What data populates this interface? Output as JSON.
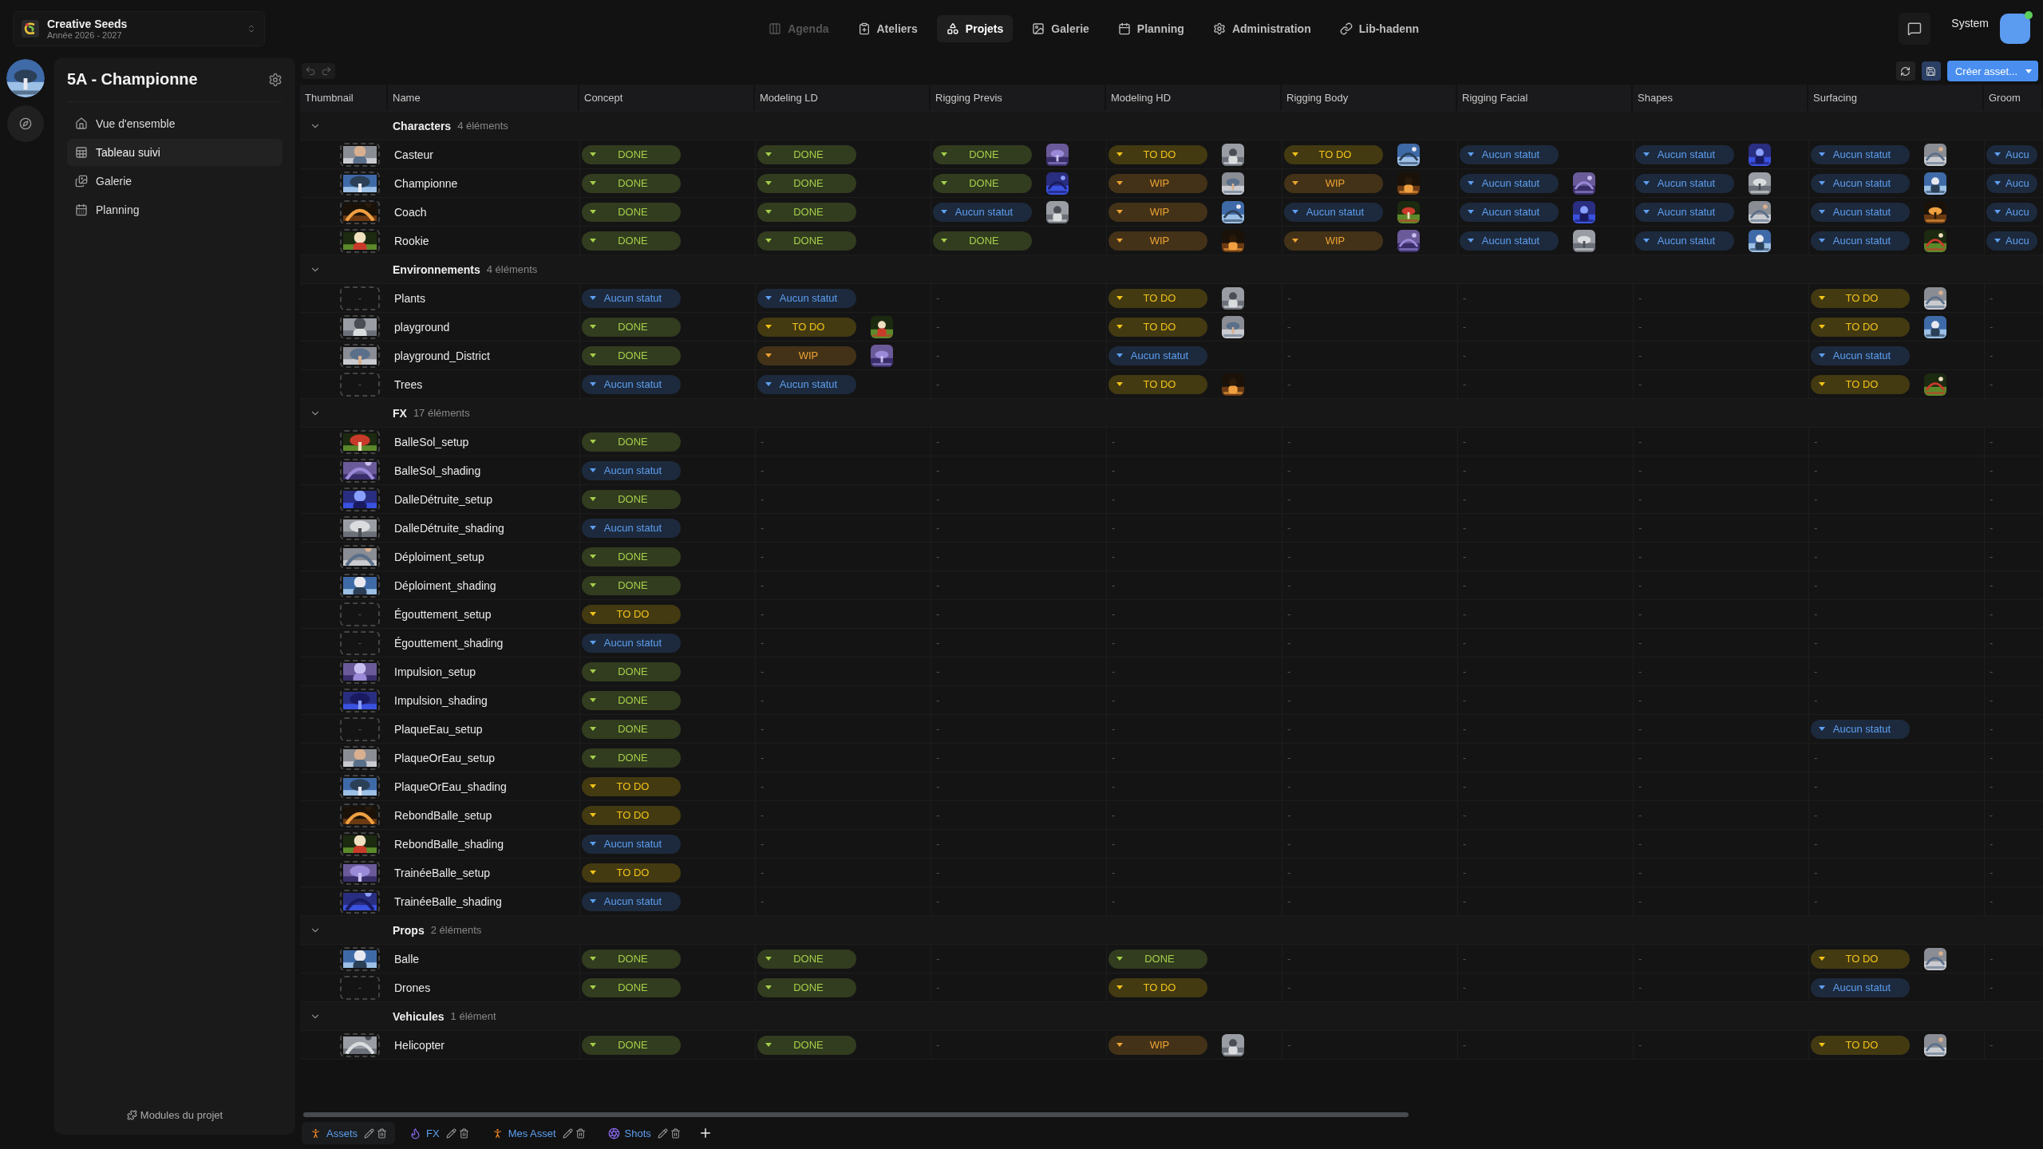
{
  "top_bar": {
    "workspace": {
      "name": "Creative Seeds",
      "subtitle": "Année 2026 - 2027"
    },
    "nav": [
      {
        "label": "Agenda",
        "selected": false,
        "disabled": true
      },
      {
        "label": "Ateliers",
        "selected": false,
        "disabled": false
      },
      {
        "label": "Projets",
        "selected": true,
        "disabled": false
      },
      {
        "label": "Galerie",
        "selected": false,
        "disabled": false
      },
      {
        "label": "Planning",
        "selected": false,
        "disabled": false
      },
      {
        "label": "Administration",
        "selected": false,
        "disabled": false
      },
      {
        "label": "Lib-hadenn",
        "selected": false,
        "disabled": false
      }
    ],
    "user": {
      "name": "System"
    }
  },
  "sidebar": {
    "title": "5A - Championne",
    "items": [
      {
        "label": "Vue d'ensemble",
        "selected": false
      },
      {
        "label": "Tableau suivi",
        "selected": true
      },
      {
        "label": "Galerie",
        "selected": false
      },
      {
        "label": "Planning",
        "selected": false
      }
    ],
    "footer": "Modules du projet"
  },
  "toolbar": {
    "undo": {
      "disabled": true
    },
    "redo": {
      "disabled": true
    },
    "create_button": "Créer asset..."
  },
  "table": {
    "columns": [
      "Thumbnail",
      "Name",
      "Concept",
      "Modeling LD",
      "Rigging Previs",
      "Modeling HD",
      "Rigging Body",
      "Rigging Facial",
      "Shapes",
      "Surfacing",
      "Groom"
    ],
    "groups": [
      {
        "name": "Characters",
        "count": "4 éléments",
        "expanded": true,
        "rows": [
          {
            "name": "Casteur",
            "cells": [
              {
                "kind": "done",
                "label": "DONE",
                "avatar": false
              },
              {
                "kind": "done",
                "label": "DONE",
                "avatar": false
              },
              {
                "kind": "done",
                "label": "DONE",
                "avatar": true
              },
              {
                "kind": "todo",
                "label": "TO DO",
                "avatar": true
              },
              {
                "kind": "todo",
                "label": "TO DO",
                "avatar": true
              },
              {
                "kind": "none",
                "label": "Aucun statut",
                "avatar": false
              },
              {
                "kind": "none",
                "label": "Aucun statut",
                "avatar": true
              },
              {
                "kind": "none",
                "label": "Aucun statut",
                "avatar": true
              },
              {
                "kind": "none",
                "label": "Aucu",
                "avatar": false
              }
            ]
          },
          {
            "name": "Championne",
            "cells": [
              {
                "kind": "done",
                "label": "DONE",
                "avatar": false
              },
              {
                "kind": "done",
                "label": "DONE",
                "avatar": false
              },
              {
                "kind": "done",
                "label": "DONE",
                "avatar": true
              },
              {
                "kind": "wip",
                "label": "WIP",
                "avatar": true
              },
              {
                "kind": "wip",
                "label": "WIP",
                "avatar": true
              },
              {
                "kind": "none",
                "label": "Aucun statut",
                "avatar": true
              },
              {
                "kind": "none",
                "label": "Aucun statut",
                "avatar": true
              },
              {
                "kind": "none",
                "label": "Aucun statut",
                "avatar": true
              },
              {
                "kind": "none",
                "label": "Aucu",
                "avatar": false
              }
            ]
          },
          {
            "name": "Coach",
            "cells": [
              {
                "kind": "done",
                "label": "DONE",
                "avatar": false
              },
              {
                "kind": "done",
                "label": "DONE",
                "avatar": false
              },
              {
                "kind": "none",
                "label": "Aucun statut",
                "avatar": true
              },
              {
                "kind": "wip",
                "label": "WIP",
                "avatar": true
              },
              {
                "kind": "none",
                "label": "Aucun statut",
                "avatar": true
              },
              {
                "kind": "none",
                "label": "Aucun statut",
                "avatar": true
              },
              {
                "kind": "none",
                "label": "Aucun statut",
                "avatar": true
              },
              {
                "kind": "none",
                "label": "Aucun statut",
                "avatar": true
              },
              {
                "kind": "none",
                "label": "Aucu",
                "avatar": false
              }
            ]
          },
          {
            "name": "Rookie",
            "cells": [
              {
                "kind": "done",
                "label": "DONE",
                "avatar": false
              },
              {
                "kind": "done",
                "label": "DONE",
                "avatar": false
              },
              {
                "kind": "done",
                "label": "DONE",
                "avatar": false
              },
              {
                "kind": "wip",
                "label": "WIP",
                "avatar": true
              },
              {
                "kind": "wip",
                "label": "WIP",
                "avatar": true
              },
              {
                "kind": "none",
                "label": "Aucun statut",
                "avatar": true
              },
              {
                "kind": "none",
                "label": "Aucun statut",
                "avatar": true
              },
              {
                "kind": "none",
                "label": "Aucun statut",
                "avatar": true
              },
              {
                "kind": "none",
                "label": "Aucu",
                "avatar": false
              }
            ]
          }
        ]
      },
      {
        "name": "Environnements",
        "count": "4 éléments",
        "expanded": true,
        "rows": [
          {
            "name": "Plants",
            "thumbnail": {
              "kind": "empty",
              "label": "-"
            },
            "cells": [
              {
                "kind": "none",
                "label": "Aucun statut",
                "avatar": false
              },
              {
                "kind": "none",
                "label": "Aucun statut",
                "avatar": false
              },
              {
                "kind": "empty",
                "label": "-"
              },
              {
                "kind": "todo",
                "label": "TO DO",
                "avatar": true
              },
              {
                "kind": "empty",
                "label": "-"
              },
              {
                "kind": "empty",
                "label": "-"
              },
              {
                "kind": "empty",
                "label": "-"
              },
              {
                "kind": "todo",
                "label": "TO DO",
                "avatar": true
              },
              {
                "kind": "empty",
                "label": "-"
              }
            ]
          },
          {
            "name": "playground",
            "cells": [
              {
                "kind": "done",
                "label": "DONE",
                "avatar": false
              },
              {
                "kind": "todo",
                "label": "TO DO",
                "avatar": true
              },
              {
                "kind": "empty",
                "label": "-"
              },
              {
                "kind": "todo",
                "label": "TO DO",
                "avatar": true
              },
              {
                "kind": "empty",
                "label": "-"
              },
              {
                "kind": "empty",
                "label": "-"
              },
              {
                "kind": "empty",
                "label": "-"
              },
              {
                "kind": "todo",
                "label": "TO DO",
                "avatar": true
              },
              {
                "kind": "empty",
                "label": "-"
              }
            ]
          },
          {
            "name": "playground_District",
            "cells": [
              {
                "kind": "done",
                "label": "DONE",
                "avatar": false
              },
              {
                "kind": "wip",
                "label": "WIP",
                "avatar": true
              },
              {
                "kind": "empty",
                "label": "-"
              },
              {
                "kind": "none",
                "label": "Aucun statut",
                "avatar": false
              },
              {
                "kind": "empty",
                "label": "-"
              },
              {
                "kind": "empty",
                "label": "-"
              },
              {
                "kind": "empty",
                "label": "-"
              },
              {
                "kind": "none",
                "label": "Aucun statut",
                "avatar": false
              },
              {
                "kind": "empty",
                "label": "-"
              }
            ]
          },
          {
            "name": "Trees",
            "thumbnail": {
              "kind": "empty",
              "label": "-"
            },
            "cells": [
              {
                "kind": "none",
                "label": "Aucun statut",
                "avatar": false
              },
              {
                "kind": "none",
                "label": "Aucun statut",
                "avatar": false
              },
              {
                "kind": "empty",
                "label": "-"
              },
              {
                "kind": "todo",
                "label": "TO DO",
                "avatar": true
              },
              {
                "kind": "empty",
                "label": "-"
              },
              {
                "kind": "empty",
                "label": "-"
              },
              {
                "kind": "empty",
                "label": "-"
              },
              {
                "kind": "todo",
                "label": "TO DO",
                "avatar": true
              },
              {
                "kind": "empty",
                "label": "-"
              }
            ]
          }
        ]
      },
      {
        "name": "FX",
        "count": "17 éléments",
        "expanded": true,
        "rows": [
          {
            "name": "BalleSol_setup",
            "cells": [
              {
                "kind": "done",
                "label": "DONE",
                "avatar": false
              },
              {
                "kind": "empty",
                "label": "-"
              },
              {
                "kind": "empty",
                "label": "-"
              },
              {
                "kind": "empty",
                "label": "-"
              },
              {
                "kind": "empty",
                "label": "-"
              },
              {
                "kind": "empty",
                "label": "-"
              },
              {
                "kind": "empty",
                "label": "-"
              },
              {
                "kind": "empty",
                "label": "-"
              },
              {
                "kind": "empty",
                "label": "-"
              }
            ]
          },
          {
            "name": "BalleSol_shading",
            "cells": [
              {
                "kind": "none",
                "label": "Aucun statut",
                "avatar": false
              },
              {
                "kind": "empty",
                "label": "-"
              },
              {
                "kind": "empty",
                "label": "-"
              },
              {
                "kind": "empty",
                "label": "-"
              },
              {
                "kind": "empty",
                "label": "-"
              },
              {
                "kind": "empty",
                "label": "-"
              },
              {
                "kind": "empty",
                "label": "-"
              },
              {
                "kind": "empty",
                "label": "-"
              },
              {
                "kind": "empty",
                "label": "-"
              }
            ]
          },
          {
            "name": "DalleDétruite_setup",
            "cells": [
              {
                "kind": "done",
                "label": "DONE",
                "avatar": false
              },
              {
                "kind": "empty",
                "label": "-"
              },
              {
                "kind": "empty",
                "label": "-"
              },
              {
                "kind": "empty",
                "label": "-"
              },
              {
                "kind": "empty",
                "label": "-"
              },
              {
                "kind": "empty",
                "label": "-"
              },
              {
                "kind": "empty",
                "label": "-"
              },
              {
                "kind": "empty",
                "label": "-"
              },
              {
                "kind": "empty",
                "label": "-"
              }
            ]
          },
          {
            "name": "DalleDétruite_shading",
            "cells": [
              {
                "kind": "none",
                "label": "Aucun statut",
                "avatar": false
              },
              {
                "kind": "empty",
                "label": "-"
              },
              {
                "kind": "empty",
                "label": "-"
              },
              {
                "kind": "empty",
                "label": "-"
              },
              {
                "kind": "empty",
                "label": "-"
              },
              {
                "kind": "empty",
                "label": "-"
              },
              {
                "kind": "empty",
                "label": "-"
              },
              {
                "kind": "empty",
                "label": "-"
              },
              {
                "kind": "empty",
                "label": "-"
              }
            ]
          },
          {
            "name": "Déploiment_setup",
            "cells": [
              {
                "kind": "done",
                "label": "DONE",
                "avatar": false
              },
              {
                "kind": "empty",
                "label": "-"
              },
              {
                "kind": "empty",
                "label": "-"
              },
              {
                "kind": "empty",
                "label": "-"
              },
              {
                "kind": "empty",
                "label": "-"
              },
              {
                "kind": "empty",
                "label": "-"
              },
              {
                "kind": "empty",
                "label": "-"
              },
              {
                "kind": "empty",
                "label": "-"
              },
              {
                "kind": "empty",
                "label": "-"
              }
            ]
          },
          {
            "name": "Déploiment_shading",
            "cells": [
              {
                "kind": "done",
                "label": "DONE",
                "avatar": false
              },
              {
                "kind": "empty",
                "label": "-"
              },
              {
                "kind": "empty",
                "label": "-"
              },
              {
                "kind": "empty",
                "label": "-"
              },
              {
                "kind": "empty",
                "label": "-"
              },
              {
                "kind": "empty",
                "label": "-"
              },
              {
                "kind": "empty",
                "label": "-"
              },
              {
                "kind": "empty",
                "label": "-"
              },
              {
                "kind": "empty",
                "label": "-"
              }
            ]
          },
          {
            "name": "Égouttement_setup",
            "thumbnail": {
              "kind": "empty",
              "label": "-"
            },
            "cells": [
              {
                "kind": "todo",
                "label": "TO DO",
                "avatar": false
              },
              {
                "kind": "empty",
                "label": "-"
              },
              {
                "kind": "empty",
                "label": "-"
              },
              {
                "kind": "empty",
                "label": "-"
              },
              {
                "kind": "empty",
                "label": "-"
              },
              {
                "kind": "empty",
                "label": "-"
              },
              {
                "kind": "empty",
                "label": "-"
              },
              {
                "kind": "empty",
                "label": "-"
              },
              {
                "kind": "empty",
                "label": "-"
              }
            ]
          },
          {
            "name": "Égouttement_shading",
            "thumbnail": {
              "kind": "empty",
              "label": "-"
            },
            "cells": [
              {
                "kind": "none",
                "label": "Aucun statut",
                "avatar": false
              },
              {
                "kind": "empty",
                "label": "-"
              },
              {
                "kind": "empty",
                "label": "-"
              },
              {
                "kind": "empty",
                "label": "-"
              },
              {
                "kind": "empty",
                "label": "-"
              },
              {
                "kind": "empty",
                "label": "-"
              },
              {
                "kind": "empty",
                "label": "-"
              },
              {
                "kind": "empty",
                "label": "-"
              },
              {
                "kind": "empty",
                "label": "-"
              }
            ]
          },
          {
            "name": "Impulsion_setup",
            "cells": [
              {
                "kind": "done",
                "label": "DONE",
                "avatar": false
              },
              {
                "kind": "empty",
                "label": "-"
              },
              {
                "kind": "empty",
                "label": "-"
              },
              {
                "kind": "empty",
                "label": "-"
              },
              {
                "kind": "empty",
                "label": "-"
              },
              {
                "kind": "empty",
                "label": "-"
              },
              {
                "kind": "empty",
                "label": "-"
              },
              {
                "kind": "empty",
                "label": "-"
              },
              {
                "kind": "empty",
                "label": "-"
              }
            ]
          },
          {
            "name": "Impulsion_shading",
            "cells": [
              {
                "kind": "done",
                "label": "DONE",
                "avatar": false
              },
              {
                "kind": "empty",
                "label": "-"
              },
              {
                "kind": "empty",
                "label": "-"
              },
              {
                "kind": "empty",
                "label": "-"
              },
              {
                "kind": "empty",
                "label": "-"
              },
              {
                "kind": "empty",
                "label": "-"
              },
              {
                "kind": "empty",
                "label": "-"
              },
              {
                "kind": "empty",
                "label": "-"
              },
              {
                "kind": "empty",
                "label": "-"
              }
            ]
          },
          {
            "name": "PlaqueEau_setup",
            "thumbnail": {
              "kind": "empty",
              "label": "-"
            },
            "cells": [
              {
                "kind": "done",
                "label": "DONE",
                "avatar": false
              },
              {
                "kind": "empty",
                "label": "-"
              },
              {
                "kind": "empty",
                "label": "-"
              },
              {
                "kind": "empty",
                "label": "-"
              },
              {
                "kind": "empty",
                "label": "-"
              },
              {
                "kind": "empty",
                "label": "-"
              },
              {
                "kind": "empty",
                "label": "-"
              },
              {
                "kind": "none",
                "label": "Aucun statut",
                "avatar": false
              },
              {
                "kind": "empty",
                "label": "-"
              }
            ]
          },
          {
            "name": "PlaqueOrEau_setup",
            "cells": [
              {
                "kind": "done",
                "label": "DONE",
                "avatar": false
              },
              {
                "kind": "empty",
                "label": "-"
              },
              {
                "kind": "empty",
                "label": "-"
              },
              {
                "kind": "empty",
                "label": "-"
              },
              {
                "kind": "empty",
                "label": "-"
              },
              {
                "kind": "empty",
                "label": "-"
              },
              {
                "kind": "empty",
                "label": "-"
              },
              {
                "kind": "empty",
                "label": "-"
              },
              {
                "kind": "empty",
                "label": "-"
              }
            ]
          },
          {
            "name": "PlaqueOrEau_shading",
            "cells": [
              {
                "kind": "todo",
                "label": "TO DO",
                "avatar": false
              },
              {
                "kind": "empty",
                "label": "-"
              },
              {
                "kind": "empty",
                "label": "-"
              },
              {
                "kind": "empty",
                "label": "-"
              },
              {
                "kind": "empty",
                "label": "-"
              },
              {
                "kind": "empty",
                "label": "-"
              },
              {
                "kind": "empty",
                "label": "-"
              },
              {
                "kind": "empty",
                "label": "-"
              },
              {
                "kind": "empty",
                "label": "-"
              }
            ]
          },
          {
            "name": "RebondBalle_setup",
            "cells": [
              {
                "kind": "todo",
                "label": "TO DO",
                "avatar": false
              },
              {
                "kind": "empty",
                "label": "-"
              },
              {
                "kind": "empty",
                "label": "-"
              },
              {
                "kind": "empty",
                "label": "-"
              },
              {
                "kind": "empty",
                "label": "-"
              },
              {
                "kind": "empty",
                "label": "-"
              },
              {
                "kind": "empty",
                "label": "-"
              },
              {
                "kind": "empty",
                "label": "-"
              },
              {
                "kind": "empty",
                "label": "-"
              }
            ]
          },
          {
            "name": "RebondBalle_shading",
            "cells": [
              {
                "kind": "none",
                "label": "Aucun statut",
                "avatar": false
              },
              {
                "kind": "empty",
                "label": "-"
              },
              {
                "kind": "empty",
                "label": "-"
              },
              {
                "kind": "empty",
                "label": "-"
              },
              {
                "kind": "empty",
                "label": "-"
              },
              {
                "kind": "empty",
                "label": "-"
              },
              {
                "kind": "empty",
                "label": "-"
              },
              {
                "kind": "empty",
                "label": "-"
              },
              {
                "kind": "empty",
                "label": "-"
              }
            ]
          },
          {
            "name": "TrainéeBalle_setup",
            "cells": [
              {
                "kind": "todo",
                "label": "TO DO",
                "avatar": false
              },
              {
                "kind": "empty",
                "label": "-"
              },
              {
                "kind": "empty",
                "label": "-"
              },
              {
                "kind": "empty",
                "label": "-"
              },
              {
                "kind": "empty",
                "label": "-"
              },
              {
                "kind": "empty",
                "label": "-"
              },
              {
                "kind": "empty",
                "label": "-"
              },
              {
                "kind": "empty",
                "label": "-"
              },
              {
                "kind": "empty",
                "label": "-"
              }
            ]
          },
          {
            "name": "TrainéeBalle_shading",
            "cells": [
              {
                "kind": "none",
                "label": "Aucun statut",
                "avatar": false
              },
              {
                "kind": "empty",
                "label": "-"
              },
              {
                "kind": "empty",
                "label": "-"
              },
              {
                "kind": "empty",
                "label": "-"
              },
              {
                "kind": "empty",
                "label": "-"
              },
              {
                "kind": "empty",
                "label": "-"
              },
              {
                "kind": "empty",
                "label": "-"
              },
              {
                "kind": "empty",
                "label": "-"
              },
              {
                "kind": "empty",
                "label": "-"
              }
            ]
          }
        ]
      },
      {
        "name": "Props",
        "count": "2 éléments",
        "expanded": true,
        "rows": [
          {
            "name": "Balle",
            "cells": [
              {
                "kind": "done",
                "label": "DONE",
                "avatar": false
              },
              {
                "kind": "done",
                "label": "DONE",
                "avatar": false
              },
              {
                "kind": "empty",
                "label": "-"
              },
              {
                "kind": "done",
                "label": "DONE",
                "avatar": false
              },
              {
                "kind": "empty",
                "label": "-"
              },
              {
                "kind": "empty",
                "label": "-"
              },
              {
                "kind": "empty",
                "label": "-"
              },
              {
                "kind": "todo",
                "label": "TO DO",
                "avatar": true
              },
              {
                "kind": "empty",
                "label": "-"
              }
            ]
          },
          {
            "name": "Drones",
            "thumbnail": {
              "kind": "empty",
              "label": "-"
            },
            "cells": [
              {
                "kind": "done",
                "label": "DONE",
                "avatar": false
              },
              {
                "kind": "done",
                "label": "DONE",
                "avatar": false
              },
              {
                "kind": "empty",
                "label": "-"
              },
              {
                "kind": "todo",
                "label": "TO DO",
                "avatar": false
              },
              {
                "kind": "empty",
                "label": "-"
              },
              {
                "kind": "empty",
                "label": "-"
              },
              {
                "kind": "empty",
                "label": "-"
              },
              {
                "kind": "none",
                "label": "Aucun statut",
                "avatar": false
              },
              {
                "kind": "empty",
                "label": "-"
              }
            ]
          }
        ]
      },
      {
        "name": "Vehicules",
        "count": "1 élément",
        "expanded": true,
        "rows": [
          {
            "name": "Helicopter",
            "cells": [
              {
                "kind": "done",
                "label": "DONE",
                "avatar": false
              },
              {
                "kind": "done",
                "label": "DONE",
                "avatar": false
              },
              {
                "kind": "empty",
                "label": "-"
              },
              {
                "kind": "wip",
                "label": "WIP",
                "avatar": true
              },
              {
                "kind": "empty",
                "label": "-"
              },
              {
                "kind": "empty",
                "label": "-"
              },
              {
                "kind": "empty",
                "label": "-"
              },
              {
                "kind": "todo",
                "label": "TO DO",
                "avatar": true
              },
              {
                "kind": "empty",
                "label": "-"
              }
            ]
          }
        ]
      }
    ]
  },
  "bottom_tabs": [
    {
      "label": "Assets",
      "selected": true
    },
    {
      "label": "FX",
      "selected": false
    },
    {
      "label": "Mes Asset",
      "selected": false
    },
    {
      "label": "Shots",
      "selected": false
    }
  ]
}
